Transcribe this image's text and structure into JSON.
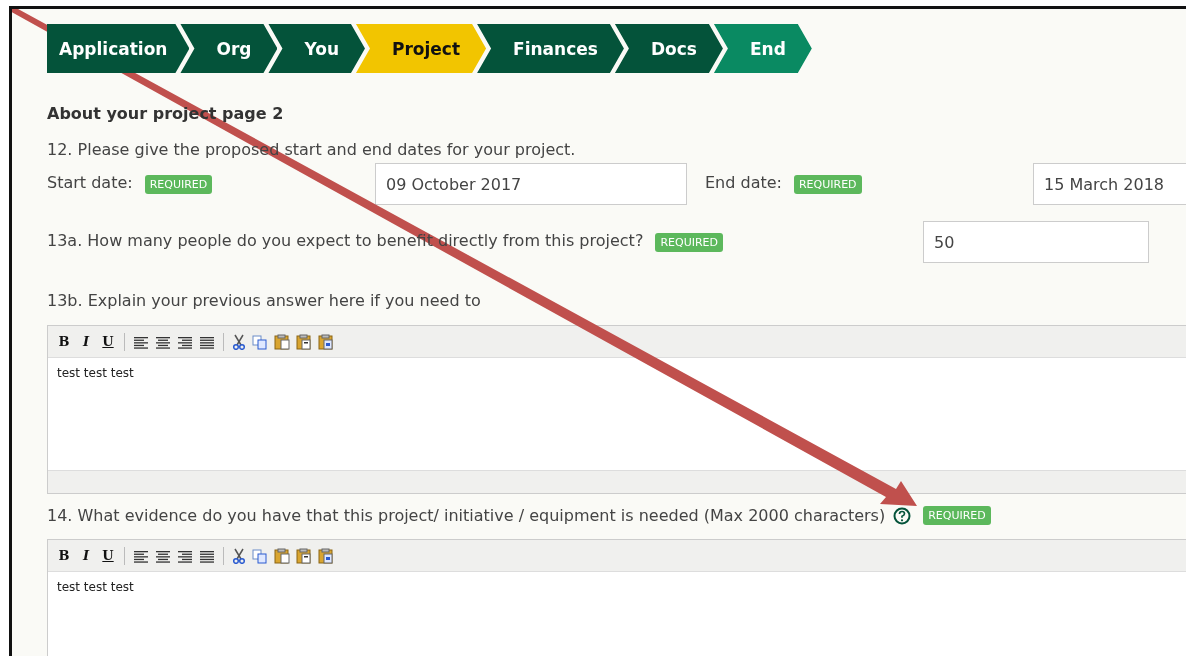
{
  "steps": [
    {
      "label": "Application",
      "selected": false,
      "kind": "step"
    },
    {
      "label": "Org",
      "selected": false,
      "kind": "step"
    },
    {
      "label": "You",
      "selected": false,
      "kind": "step"
    },
    {
      "label": "Project",
      "selected": true,
      "kind": "step"
    },
    {
      "label": "Finances",
      "selected": false,
      "kind": "step"
    },
    {
      "label": "Docs",
      "selected": false,
      "kind": "step"
    },
    {
      "label": "End",
      "selected": false,
      "kind": "final"
    }
  ],
  "heading": "About your project page 2",
  "q12": {
    "question": "12. Please give the proposed start and end dates for your project.",
    "start_label": "Start date:",
    "start_badge": "REQUIRED",
    "start_value": "09 October 2017",
    "end_label": "End date:",
    "end_badge": "REQUIRED",
    "end_value": "15 March 2018"
  },
  "q13a": {
    "question": "13a. How many people do you expect to benefit directly from this project?",
    "badge": "REQUIRED",
    "value": "50"
  },
  "q13b": {
    "question": "13b. Explain your previous answer here if you need to",
    "toolbar": [
      "B",
      "I",
      "U"
    ],
    "text": "test test test"
  },
  "q14": {
    "question": "14. What evidence do you have that this project/ initiative / equipment is needed (Max 2000 characters)",
    "badge": "REQUIRED",
    "toolbar": [
      "B",
      "I",
      "U"
    ],
    "text": "test test test"
  }
}
